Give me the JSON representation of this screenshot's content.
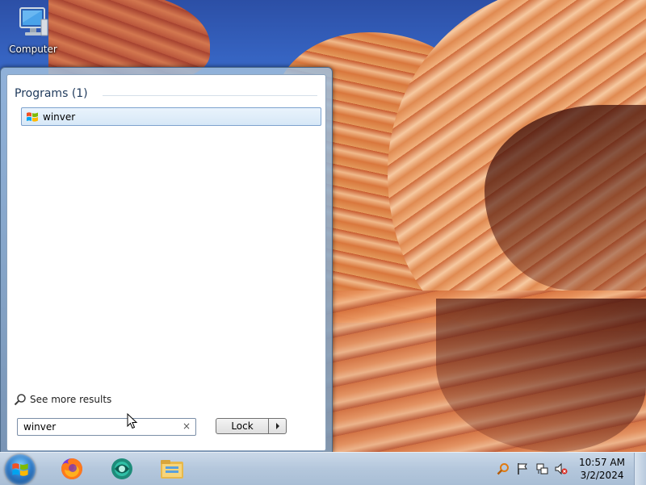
{
  "desktop": {
    "icons": [
      {
        "label": "Computer",
        "icon": "computer-icon"
      }
    ]
  },
  "start_menu": {
    "programs_header": "Programs (1)",
    "results": [
      {
        "label": "winver",
        "icon": "windows-flag-icon"
      }
    ],
    "see_more": "See more results",
    "search": {
      "value": "winver",
      "clear_glyph": "×"
    },
    "power_button": {
      "label": "Lock"
    }
  },
  "taskbar": {
    "pinned": [
      {
        "name": "start-button",
        "icon": "windows-logo-icon"
      },
      {
        "name": "firefox",
        "icon": "firefox-icon"
      },
      {
        "name": "app-globe",
        "icon": "globe-app-icon"
      },
      {
        "name": "file-explorer",
        "icon": "folder-icon"
      }
    ],
    "tray": {
      "icons": [
        "search-icon",
        "flag-icon",
        "network-icon",
        "volume-muted-icon"
      ],
      "time": "10:57 AM",
      "date": "3/2/2024"
    }
  },
  "colors": {
    "taskbar": "#b4c7dc",
    "selection": "#d7e8f7",
    "selection_border": "#7da2ce",
    "header_text": "#1e395b"
  }
}
